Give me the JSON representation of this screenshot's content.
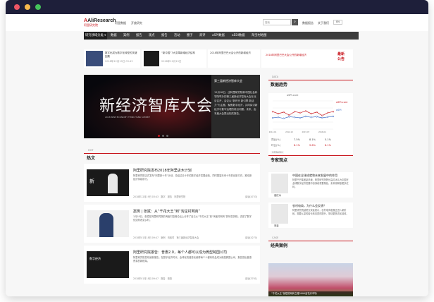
{
  "colors": {
    "brand": "#c8161d",
    "nav_bg": "#3b3b3b",
    "titlebar": "#1e1f3a",
    "dot_red": "#ed5565",
    "dot_yellow": "#f7b94d",
    "dot_green": "#45c35b"
  },
  "header": {
    "logo_main": "AliResearch",
    "logo_cn": "阿里研究院",
    "links": [
      "阿里数据",
      "开放研究"
    ],
    "search_placeholder": "搜索",
    "search_icon": "search-icon",
    "user_links": [
      "数据报告",
      "关于我们"
    ],
    "lang": "EN"
  },
  "nav": {
    "items": [
      "研究领域分类 ▾",
      "数据",
      "案例",
      "报告",
      "观点",
      "报告",
      "活动",
      "圈子",
      "商评",
      "aSPI数据",
      "aEDI数据",
      "淘宝村地图"
    ]
  },
  "top_news": [
    {
      "text": "数字化成为数字化转型的关键因素",
      "sub": "2018年12月19日 03:43"
    },
    {
      "text": "“新中国”7大变革新增经济结构",
      "sub": "2018年12月19日"
    },
    {
      "text": "2018年阿里巴巴大会公开的新增经济",
      "sub": ""
    }
  ],
  "news_label": [
    "最新",
    "公告"
  ],
  "banner": {
    "title": "新经济智库大会",
    "subtitle": "2018 NEW ECONOMY THINK TANK SUMMIT",
    "side_title": "第三届新经济智库大会",
    "side_text": "12月18日，由阿里研究院和中国社会科学院举办的第三届新经济智库大会在北京召开，会议以“新时代 新引擎 新活力”为主题，聚焦数字经济，共同探讨新经济与数字治理的前沿问题。未来，由本届大会提出相关报告。"
  },
  "hot": {
    "tag": "HOT",
    "title": "热文",
    "articles": [
      {
        "title": "阿里研究院发布2018年阿里店木计划",
        "desc": "阿里研究院正式发布“阿里新十年”计划，总结过去十年的数字经济发展经验，同时展望未来十年的创新方向，推动新经济持续前行。",
        "date": "2018年12月19日 03:43",
        "tags": [
          "数字",
          "报告",
          "阿里研究院"
        ],
        "read": "阅读(4733)"
      },
      {
        "title": "案例 | 张斌：从“千花大王”到“淘宝村网商”",
        "desc": "1月18日，张斌在阿里研究院的淘宝村高峰论坛上分享了自己从“千花大王”到“淘宝村网商”的转变历程，讲述了数字化如何改变乡村。",
        "date": "2018年01月18日 09:47",
        "tags": [
          "案例",
          "淘宝村",
          "第三届新经济智库大会"
        ],
        "read": "阅读(4270)"
      },
      {
        "title": "阿里研究院报告：普惠2.0，每个人都可以成为微型跨国公司",
        "desc": "阿里研究院发布最新报告，在数字经济时代，全球化的普惠化使得每个人都有机会成为微型跨国公司，报告提出普惠贸易的新框架。",
        "date": "2018年01月18日 09:47",
        "tags": [
          "报告",
          "普惠"
        ],
        "read": "阅读(3761)"
      }
    ]
  },
  "data_section": {
    "tag": "DATA",
    "title": "数据趋势",
    "tabs": [
      "aSPI-core",
      "aSPI"
    ],
    "legend": [
      "年增长",
      "年增长"
    ],
    "table_rows": [
      {
        "label": "同比(%)",
        "values": [
          "7.5%",
          "8.1%",
          "5.1%"
        ]
      },
      {
        "label": "环比(%)",
        "values": [
          "8.1%",
          "9.6%",
          "8.1%"
        ]
      }
    ]
  },
  "chart_data": {
    "type": "line",
    "title": "",
    "x": [
      "2014.01",
      "2014.04",
      "2014.07",
      "2014.10",
      "2015.01",
      "2015.04",
      "2015.07",
      "2015.10",
      "2016.01",
      "2016.04",
      "2016.07",
      "2016.10"
    ],
    "series": [
      {
        "name": "aSPI-core",
        "values": [
          62,
          55,
          60,
          50,
          62,
          58,
          64,
          55,
          60,
          48,
          58,
          62
        ]
      },
      {
        "name": "aSPI",
        "values": [
          40,
          42,
          38,
          44,
          42,
          40,
          45,
          42,
          44,
          40,
          43,
          45
        ]
      }
    ],
    "ylim": [
      0,
      100
    ],
    "grid": true,
    "legend": "right"
  },
  "opinion": {
    "tag": "OPINION",
    "title": "专家观点",
    "items": [
      {
        "name": "高红冰",
        "title": "中国在全球成就和未来发展中的作用",
        "text": "阿里巴巴集团副总裁、阿里研究院院长高红冰认为中国在全球数字经济发展中扮演着重要角色，未来将释放更多红利。"
      },
      {
        "name": "宋斐",
        "title": "农村电商，为什么会反馈？",
        "text": "阿里研究院副院长宋斐表示，农村电商发展正进入新阶段，需要从量的增长转向质的提升，带动更多农民增收。"
      }
    ]
  },
  "case": {
    "tag": "CASE",
    "title": "经典案例",
    "caption": "“千花大王”张斌的网商之路3000亩花卉市场"
  }
}
